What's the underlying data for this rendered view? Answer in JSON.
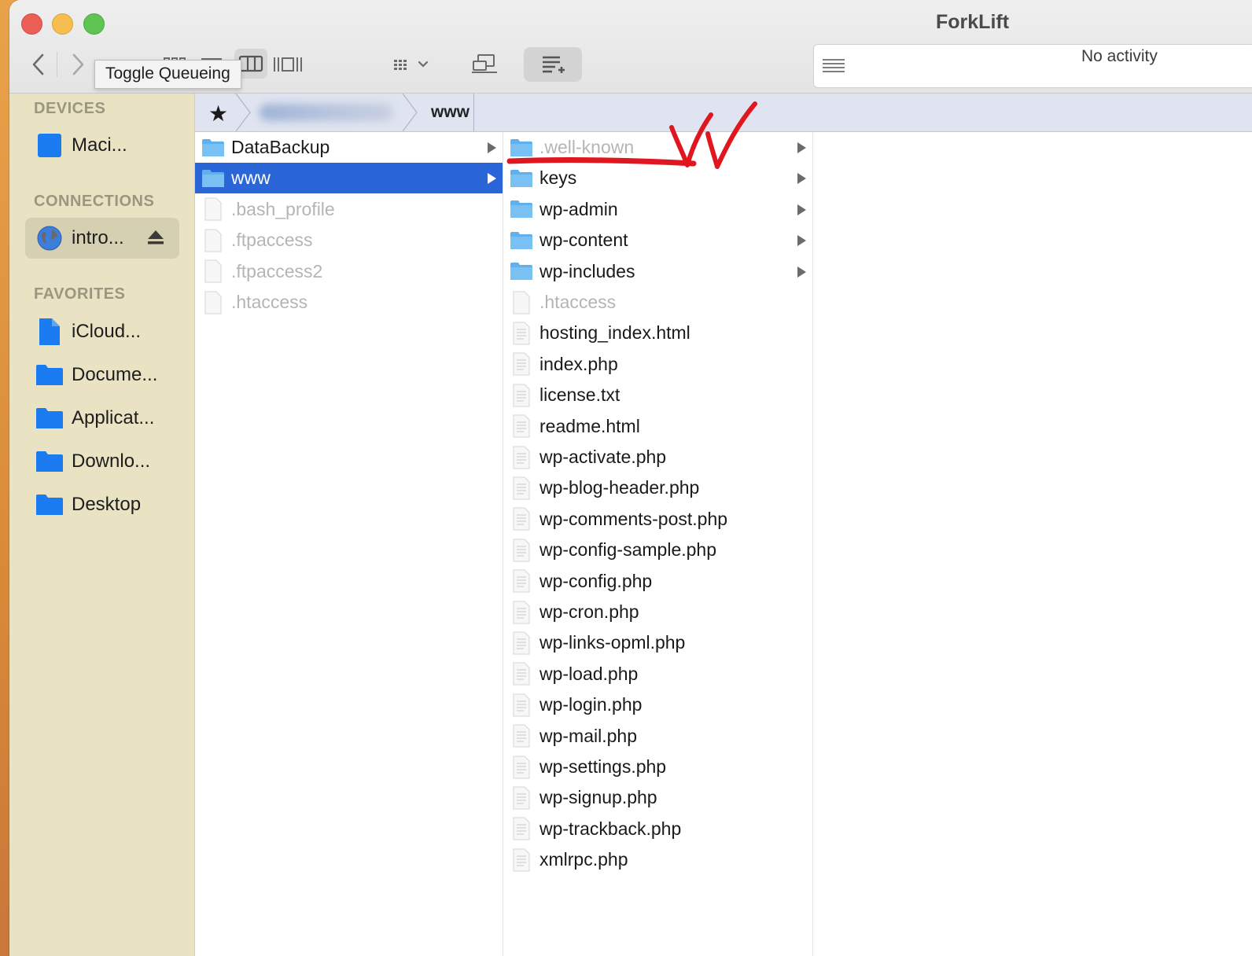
{
  "window": {
    "title": "ForkLift",
    "tooltip": "Toggle Queueing",
    "activity": "No activity"
  },
  "toolbar": {
    "icons": [
      "chevron-left-icon",
      "chevron-right-icon",
      "grid-view-icon",
      "list-view-icon",
      "column-view-icon",
      "cover-flow-icon",
      "group-by-icon",
      "connect-icon",
      "queue-icon",
      "activity-list-icon"
    ]
  },
  "sidebar": {
    "devices_header": "DEVICES",
    "devices": [
      {
        "label": "Maci...",
        "icon": "drive-icon"
      }
    ],
    "connections_header": "CONNECTIONS",
    "connections": [
      {
        "label": "intro...",
        "icon": "globe-icon"
      }
    ],
    "favorites_header": "FAVORITES",
    "favorites": [
      {
        "label": "iCloud...",
        "icon": "document-icon"
      },
      {
        "label": "Docume...",
        "icon": "folder-icon"
      },
      {
        "label": "Applicat...",
        "icon": "folder-icon"
      },
      {
        "label": "Downlo...",
        "icon": "folder-icon"
      },
      {
        "label": "Desktop",
        "icon": "folder-icon"
      }
    ]
  },
  "pathbar": {
    "current": "www"
  },
  "column1": [
    {
      "name": "DataBackup",
      "type": "folder"
    },
    {
      "name": "www",
      "type": "folder",
      "selected": true
    },
    {
      "name": ".bash_profile",
      "type": "file",
      "hidden": true
    },
    {
      "name": ".ftpaccess",
      "type": "file",
      "hidden": true
    },
    {
      "name": ".ftpaccess2",
      "type": "file",
      "hidden": true
    },
    {
      "name": ".htaccess",
      "type": "file",
      "hidden": true
    }
  ],
  "column2": [
    {
      "name": ".well-known",
      "type": "folder",
      "hidden": true
    },
    {
      "name": "keys",
      "type": "folder"
    },
    {
      "name": "wp-admin",
      "type": "folder"
    },
    {
      "name": "wp-content",
      "type": "folder"
    },
    {
      "name": "wp-includes",
      "type": "folder"
    },
    {
      "name": ".htaccess",
      "type": "file",
      "hidden": true
    },
    {
      "name": "hosting_index.html",
      "type": "file"
    },
    {
      "name": "index.php",
      "type": "file"
    },
    {
      "name": "license.txt",
      "type": "file"
    },
    {
      "name": "readme.html",
      "type": "file"
    },
    {
      "name": "wp-activate.php",
      "type": "file"
    },
    {
      "name": "wp-blog-header.php",
      "type": "file"
    },
    {
      "name": "wp-comments-post.php",
      "type": "file"
    },
    {
      "name": "wp-config-sample.php",
      "type": "file"
    },
    {
      "name": "wp-config.php",
      "type": "file"
    },
    {
      "name": "wp-cron.php",
      "type": "file"
    },
    {
      "name": "wp-links-opml.php",
      "type": "file"
    },
    {
      "name": "wp-load.php",
      "type": "file"
    },
    {
      "name": "wp-login.php",
      "type": "file"
    },
    {
      "name": "wp-mail.php",
      "type": "file"
    },
    {
      "name": "wp-settings.php",
      "type": "file"
    },
    {
      "name": "wp-signup.php",
      "type": "file"
    },
    {
      "name": "wp-trackback.php",
      "type": "file"
    },
    {
      "name": "xmlrpc.php",
      "type": "file"
    }
  ],
  "colors": {
    "selection": "#2b66d9",
    "folder": "#5eb0ee",
    "sidebar_folder": "#1a7cf0",
    "sidebar_bg": "#e9e3c4",
    "pathbar_bg": "#dfe4f0",
    "annotation": "#e0171f"
  }
}
